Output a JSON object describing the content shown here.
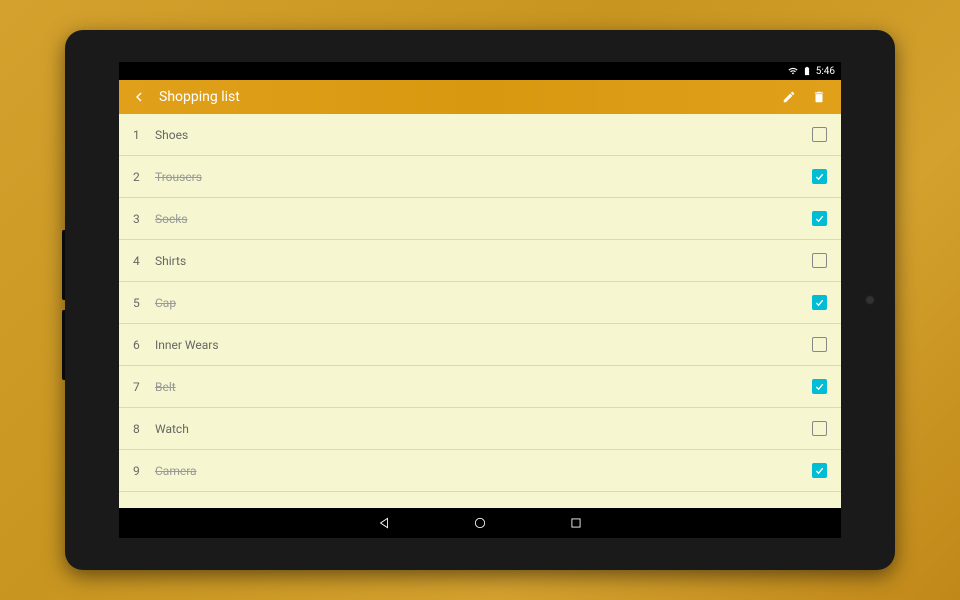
{
  "statusBar": {
    "time": "5:46"
  },
  "appBar": {
    "title": "Shopping list"
  },
  "items": [
    {
      "num": "1",
      "label": "Shoes",
      "checked": false
    },
    {
      "num": "2",
      "label": "Trousers",
      "checked": true
    },
    {
      "num": "3",
      "label": "Socks",
      "checked": true
    },
    {
      "num": "4",
      "label": "Shirts",
      "checked": false
    },
    {
      "num": "5",
      "label": "Cap",
      "checked": true
    },
    {
      "num": "6",
      "label": "Inner Wears",
      "checked": false
    },
    {
      "num": "7",
      "label": "Belt",
      "checked": true
    },
    {
      "num": "8",
      "label": "Watch",
      "checked": false
    },
    {
      "num": "9",
      "label": "Camera",
      "checked": true
    }
  ]
}
